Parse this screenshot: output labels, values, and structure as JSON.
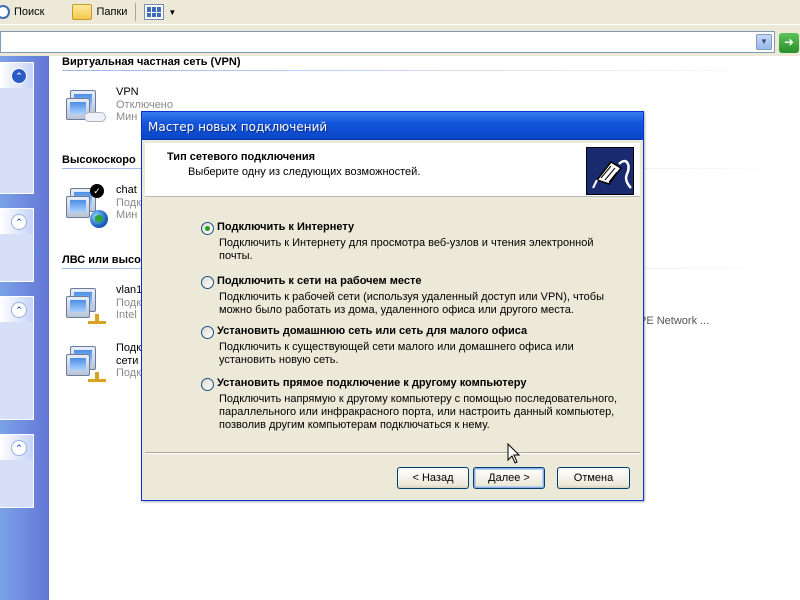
{
  "toolbar": {
    "search_label": "Поиск",
    "folders_label": "Папки"
  },
  "addressbar": {
    "go_icon": "go-arrow-icon"
  },
  "main": {
    "groups": [
      {
        "header": "Виртуальная частная сеть (VPN)"
      },
      {
        "header": "Высокоскоро"
      },
      {
        "header": "ЛВС или высо"
      }
    ],
    "connections": [
      {
        "line1": "VPN",
        "line2": "Отключено",
        "line3": "Мин"
      },
      {
        "line1": "chat",
        "line2": "Подк",
        "line3": "Мин"
      },
      {
        "line1": "vlan1",
        "line2": "Подк",
        "line3": "Intel"
      },
      {
        "line1": "Подк",
        "line2": "сети",
        "line3": "Подк"
      }
    ],
    "truncated_text": "PE Network ..."
  },
  "dialog": {
    "title": "Мастер новых подключений",
    "heading": "Тип сетевого подключения",
    "subheading": "Выберите одну из следующих возможностей.",
    "options": [
      {
        "label": "Подключить к Интернету",
        "desc": "Подключить к Интернету для просмотра веб-узлов и чтения  электронной почты.",
        "selected": true
      },
      {
        "label": "Подключить к сети на рабочем месте",
        "desc": "Подключить к рабочей сети (используя удаленный доступ или VPN), чтобы можно было работать из дома, удаленного офиса или другого места.",
        "selected": false
      },
      {
        "label": "Установить домашнюю сеть или сеть для малого офиса",
        "desc": "Подключить к существующей сети малого или домашнего офиса или установить новую сеть.",
        "selected": false
      },
      {
        "label": "Установить прямое подключение к другому компьютеру",
        "desc": "Подключить напрямую к другому компьютеру с помощью последовательного, параллельного или инфракрасного порта, или настроить данный компьютер, позволив другим  компьютерам подключаться к нему.",
        "selected": false
      }
    ],
    "buttons": {
      "back": "< Назад",
      "next": "Далее >",
      "cancel": "Отмена"
    }
  },
  "colors": {
    "titlebar": "#0a46c7",
    "taskpane": "#6375d6",
    "radio_selected": "#21a121"
  }
}
